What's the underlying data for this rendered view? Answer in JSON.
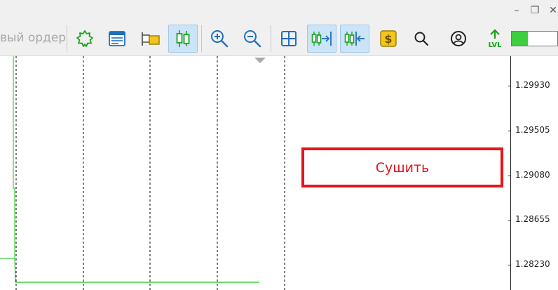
{
  "window": {
    "minimize_glyph": "–",
    "restore_glyph": "❐",
    "close_glyph": "✕"
  },
  "toolbar": {
    "order_label": "вый ордер",
    "buttons": [
      {
        "name": "settings-gear-icon",
        "active": false
      },
      {
        "name": "market-watch-icon",
        "active": false
      },
      {
        "name": "open-folder-icon",
        "active": false
      },
      {
        "name": "candlestick-icon",
        "active": true
      },
      {
        "name": "zoom-in-icon",
        "active": false
      },
      {
        "name": "zoom-out-icon",
        "active": false
      },
      {
        "name": "grid-icon",
        "active": false
      },
      {
        "name": "chart-shift-icon",
        "active": true
      },
      {
        "name": "auto-scroll-icon",
        "active": true
      },
      {
        "name": "dollar-icon",
        "active": false
      },
      {
        "name": "search-icon",
        "active": false
      },
      {
        "name": "account-icon",
        "active": false
      },
      {
        "name": "level-icon",
        "active": false
      }
    ],
    "level_text": "LVL",
    "level_fraction": 0.35,
    "accent_green": "#3dcf3d",
    "accent_blue": "#1f6fbf"
  },
  "price_axis": {
    "labels": [
      "1.29930",
      "1.29505",
      "1.29080",
      "1.28655",
      "1.28230"
    ]
  },
  "chart": {
    "price_line_color": "#3dcf3d",
    "grid_color": "#000000"
  },
  "overlay": {
    "button_label": "Сушить",
    "button_color": "#e8141b"
  }
}
